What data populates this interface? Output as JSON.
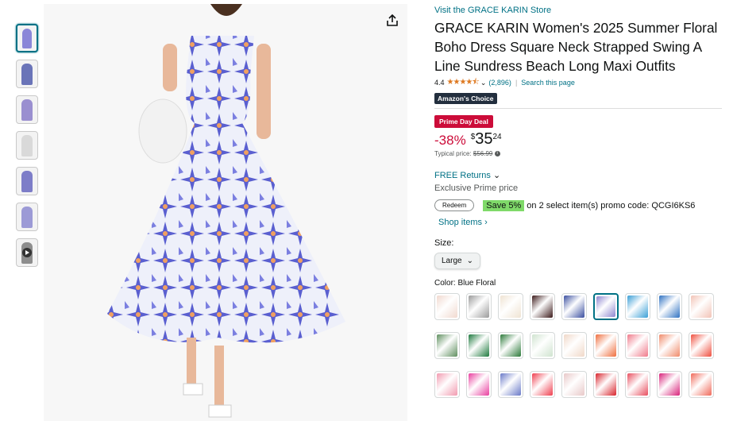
{
  "thumbnails": [
    {
      "name": "thumb-1",
      "color": "#8a86d8",
      "active": true
    },
    {
      "name": "thumb-2",
      "color": "#6a74b8",
      "active": false
    },
    {
      "name": "thumb-3",
      "color": "#9a8fd0",
      "active": false
    },
    {
      "name": "thumb-4",
      "color": "#d9d9d9",
      "active": false
    },
    {
      "name": "thumb-5",
      "color": "#7d7dc8",
      "active": false
    },
    {
      "name": "thumb-6",
      "color": "#9c9ad6",
      "active": false
    },
    {
      "name": "thumb-7",
      "color": "#8e8e8e",
      "active": false,
      "video": true
    }
  ],
  "product": {
    "store_link": "Visit the GRACE KARIN Store",
    "title": "GRACE KARIN Women's 2025 Summer Floral Boho Dress Square Neck Strapped Swing A Line Sundress Beach Long Maxi Outfits",
    "rating": "4.4",
    "stars": "★★★★⯪",
    "review_count": "(2,896)",
    "search_link": "Search this page",
    "badge": "Amazon's Choice",
    "deal_badge": "Prime Day Deal",
    "discount": "-38%",
    "currency": "$",
    "price_whole": "35",
    "price_fraction": "24",
    "typical_label": "Typical price: ",
    "typical_price": "$56.99",
    "free_returns": "FREE Returns",
    "exclusive_prime": "Exclusive Prime price",
    "redeem_label": "Redeem",
    "save_text": "Save 5%",
    "promo_text": "on 2 select item(s) promo code: QCGI6KS6",
    "shop_items": "Shop items ›",
    "size_label": "Size:",
    "size_value": "Large",
    "color_label": "Color: ",
    "color_value": "Blue Floral"
  },
  "swatches": [
    "#f1d9cf",
    "#9a9a9a",
    "#efe3d2",
    "#3b1a1a",
    "#3a4fa0",
    "#8e86d0",
    "#3a9fd6",
    "#2f72c2",
    "#f2c3b6",
    "#5f8f5f",
    "#1e7a3e",
    "#2c7a3a",
    "#cfe3cf",
    "#f0d8c8",
    "#ef6f3f",
    "#f07a8a",
    "#f08a6a",
    "#ef4f3f",
    "#f29ab0",
    "#e93f9f",
    "#6a7ac8",
    "#ef3f4f",
    "#e8c8c8",
    "#d8242c",
    "#e84f5f",
    "#d8227a",
    "#f06a5a"
  ],
  "selected_swatch": 5,
  "colors": {
    "link": "#007185",
    "deal": "#cc0c39",
    "choice_bg": "#232f3e",
    "save_bg": "#7fda69",
    "star": "#de7921"
  }
}
